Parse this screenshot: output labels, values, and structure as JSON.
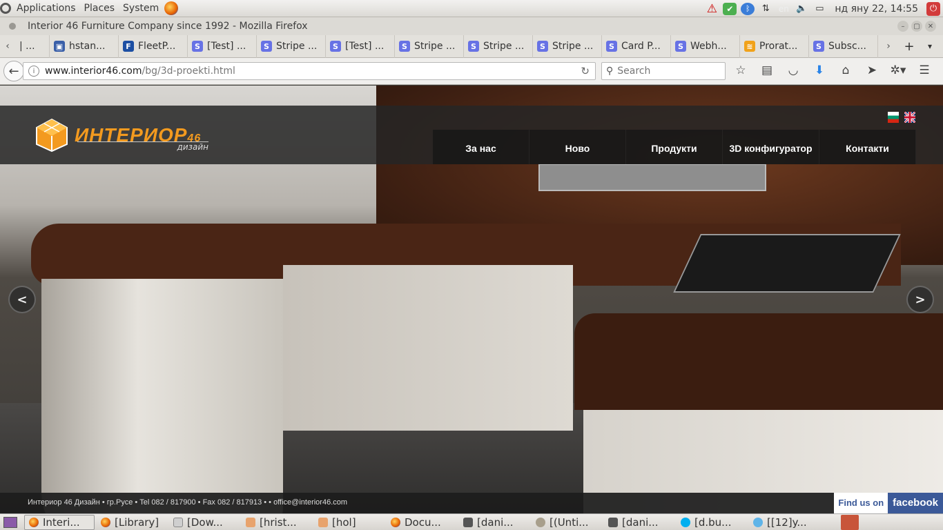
{
  "top_panel": {
    "menus": [
      "Applications",
      "Places",
      "System"
    ],
    "tray_lang": "en",
    "clock": "нд яну 22, 14:55"
  },
  "window": {
    "title": "Interior 46 Furniture Company since 1992 - Mozilla Firefox"
  },
  "tabs": [
    {
      "label": "| ...",
      "icon": "hstack-icon"
    },
    {
      "label": "hstan...",
      "icon": "hstack-icon"
    },
    {
      "label": "FleetP...",
      "icon": "fleetp-icon"
    },
    {
      "label": "[Test] ...",
      "icon": "stripe-icon"
    },
    {
      "label": "Stripe ...",
      "icon": "stripe-icon"
    },
    {
      "label": "[Test] ...",
      "icon": "stripe-icon"
    },
    {
      "label": "Stripe ...",
      "icon": "stripe-icon"
    },
    {
      "label": "Stripe ...",
      "icon": "stripe-icon"
    },
    {
      "label": "Stripe ...",
      "icon": "stripe-icon"
    },
    {
      "label": "Card P...",
      "icon": "stripe-icon"
    },
    {
      "label": "Webh...",
      "icon": "stripe-icon"
    },
    {
      "label": "Prorat...",
      "icon": "rss-icon"
    },
    {
      "label": "Subsc...",
      "icon": "stripe-icon"
    }
  ],
  "navbar": {
    "url_host": "www.interior46.com",
    "url_path": "/bg/3d-proekti.html",
    "search_placeholder": "Search"
  },
  "site": {
    "logo_text": "ИНТЕРИОР",
    "logo_num": "46",
    "logo_sub": "дизайн",
    "nav": [
      "За нас",
      "Ново",
      "Продукти",
      "3D конфигуратор",
      "Контакти"
    ],
    "prev_arrow": "<",
    "next_arrow": ">",
    "footer_info": "Интериор 46 Дизайн • гр.Русе • Tel 082 / 817900 • Fax 082 / 817913 • • office@interior46.com",
    "find_us": "Find us on",
    "facebook": "facebook"
  },
  "taskbar": {
    "items": [
      {
        "label": "Interi...",
        "icon": "firefox-icon",
        "active": true
      },
      {
        "label": "[Library]",
        "icon": "firefox-icon",
        "active": false
      },
      {
        "label": "[Dow...",
        "icon": "document-icon",
        "active": false
      },
      {
        "label": "[hrist...",
        "icon": "folder-icon",
        "active": false
      },
      {
        "label": "[hol]",
        "icon": "folder-icon",
        "active": false
      },
      {
        "label": "Docu...",
        "icon": "firefox-icon",
        "active": false
      },
      {
        "label": "[dani...",
        "icon": "terminal-icon",
        "active": false
      },
      {
        "label": "[(Unti...",
        "icon": "gimp-icon",
        "active": false
      },
      {
        "label": "[dani...",
        "icon": "terminal-icon",
        "active": false
      },
      {
        "label": "[d.bu...",
        "icon": "skype-icon",
        "active": false
      },
      {
        "label": "[[12]y...",
        "icon": "pidgin-icon",
        "active": false
      }
    ]
  }
}
